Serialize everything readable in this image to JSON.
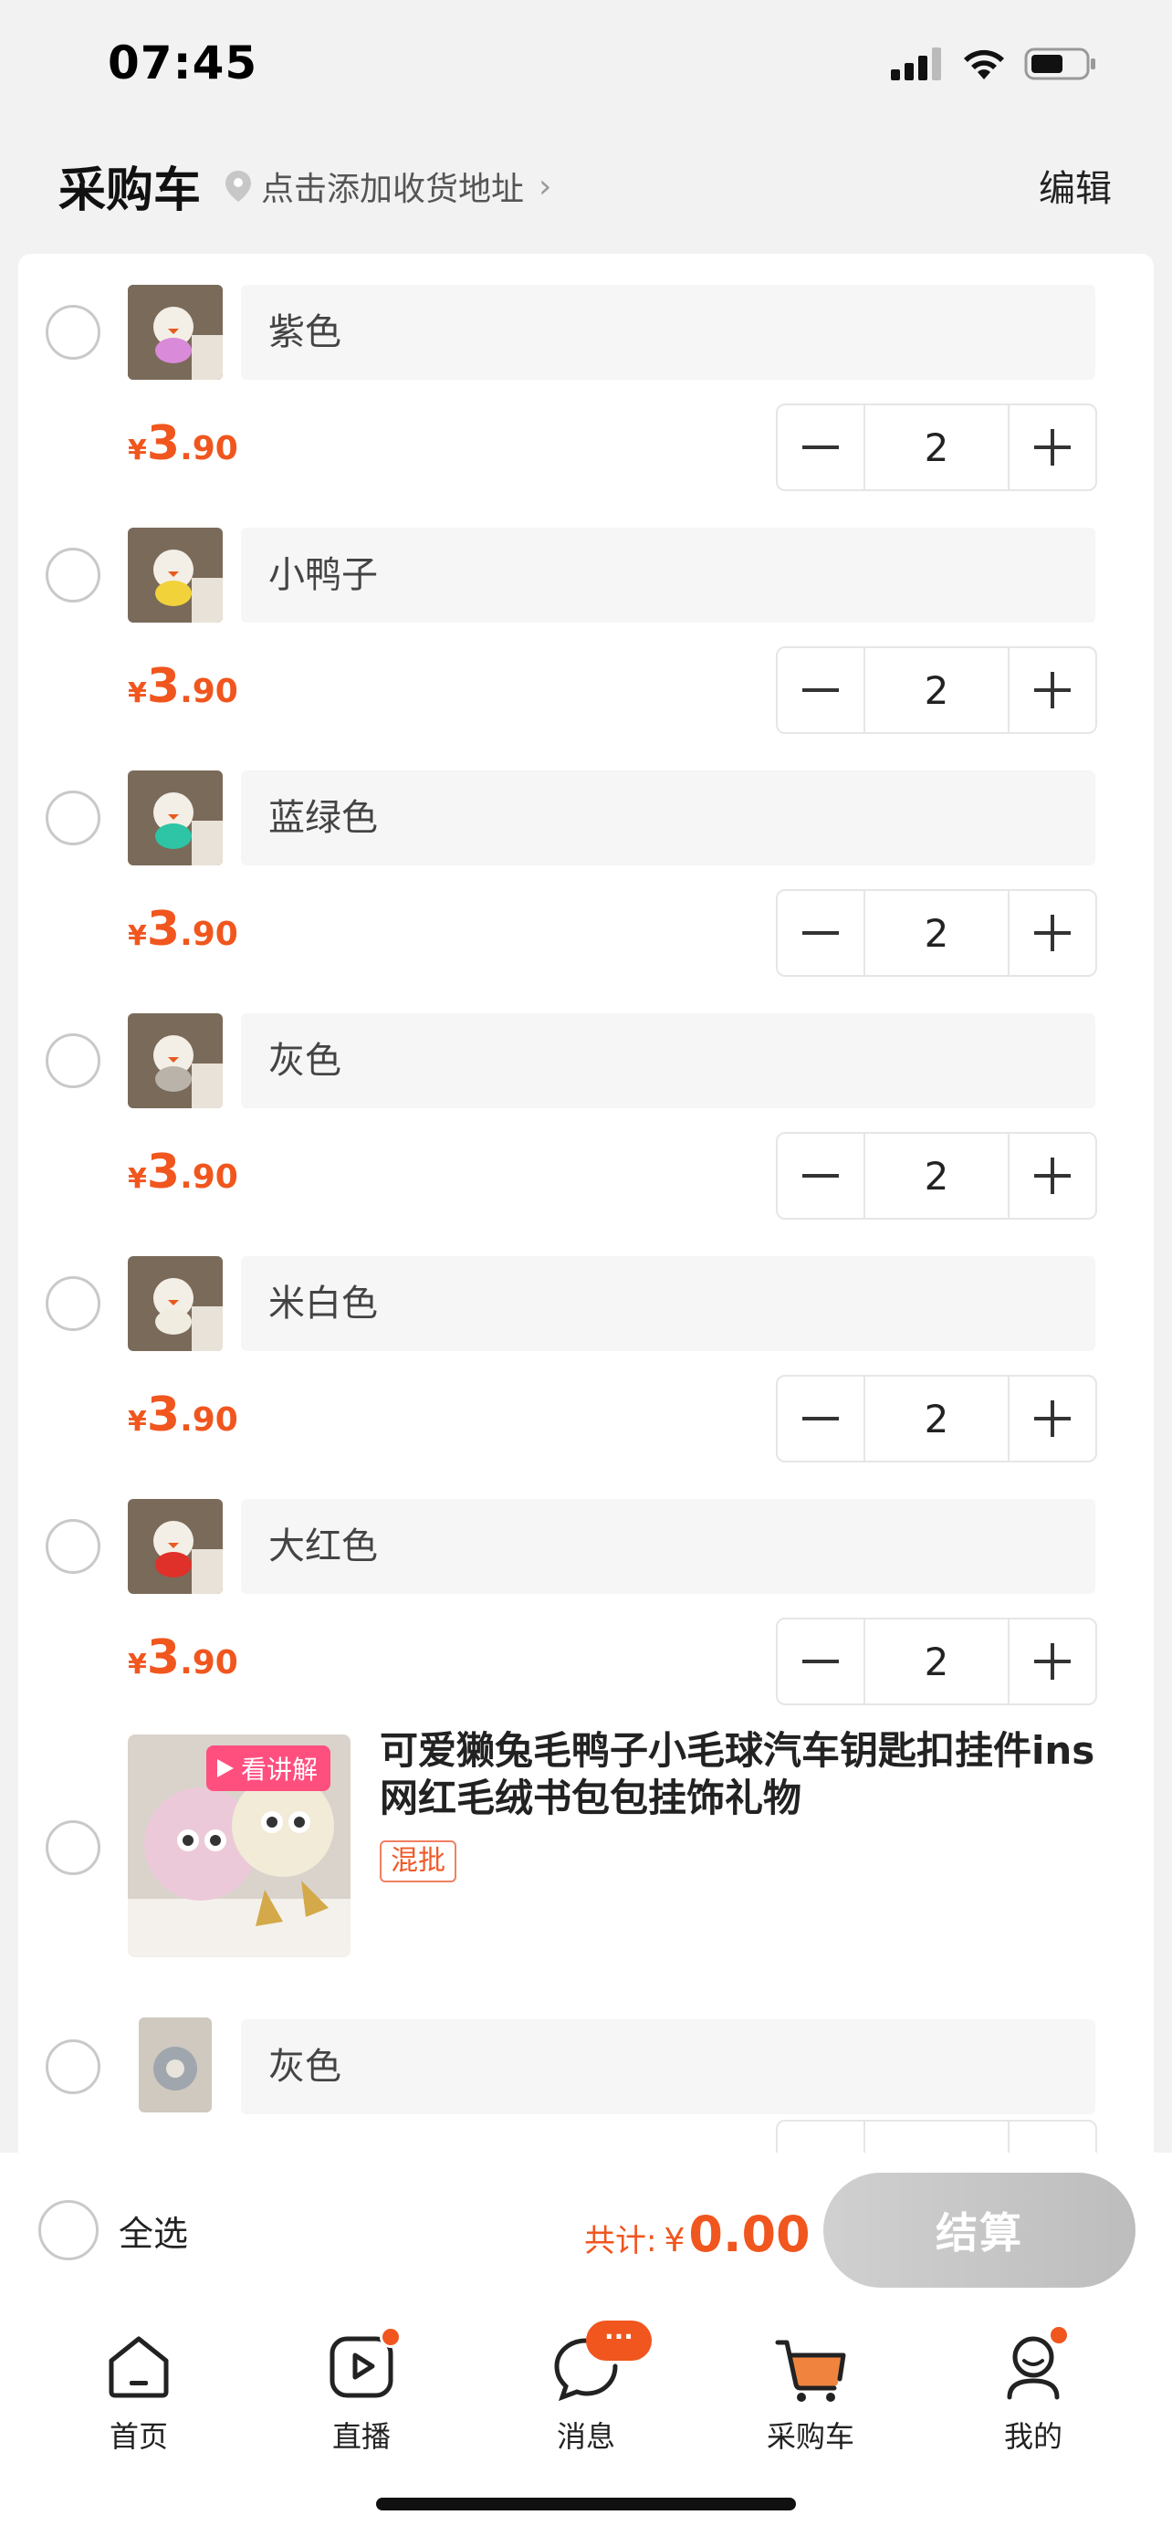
{
  "status_bar": {
    "time": "07:45",
    "icons": [
      "signal-icon",
      "wifi-icon",
      "battery-icon"
    ]
  },
  "header": {
    "title": "采购车",
    "address": "点击添加收货地址",
    "edit": "编辑"
  },
  "cart": {
    "items": [
      {
        "variant": "紫色",
        "price_yen": "¥",
        "price_int": "3",
        "price_dec": ".90",
        "qty": "2",
        "thumb_color": "#d98ad9"
      },
      {
        "variant": "小鸭子",
        "price_yen": "¥",
        "price_int": "3",
        "price_dec": ".90",
        "qty": "2",
        "thumb_color": "#f2d23b"
      },
      {
        "variant": "蓝绿色",
        "price_yen": "¥",
        "price_int": "3",
        "price_dec": ".90",
        "qty": "2",
        "thumb_color": "#2ec4a6"
      },
      {
        "variant": "灰色",
        "price_yen": "¥",
        "price_int": "3",
        "price_dec": ".90",
        "qty": "2",
        "thumb_color": "#b9b3aa"
      },
      {
        "variant": "米白色",
        "price_yen": "¥",
        "price_int": "3",
        "price_dec": ".90",
        "qty": "2",
        "thumb_color": "#f1ece0"
      },
      {
        "variant": "大红色",
        "price_yen": "¥",
        "price_int": "3",
        "price_dec": ".90",
        "qty": "2",
        "thumb_color": "#e0302a"
      }
    ],
    "product": {
      "badge": "看讲解",
      "title": "可爱獭兔毛鸭子小毛球汽车钥匙扣挂件ins网红毛绒书包包挂饰礼物",
      "tag": "混批"
    },
    "partial_item": {
      "variant": "灰色"
    }
  },
  "checkout": {
    "select_all": "全选",
    "total_label": "共计:",
    "total_yen": "¥",
    "total_value": "0.00",
    "button": "结算"
  },
  "tabs": [
    {
      "label": "首页",
      "icon": "home-icon"
    },
    {
      "label": "直播",
      "icon": "live-icon"
    },
    {
      "label": "消息",
      "icon": "message-icon",
      "badge": "···"
    },
    {
      "label": "采购车",
      "icon": "cart-icon"
    },
    {
      "label": "我的",
      "icon": "profile-icon"
    }
  ],
  "colors": {
    "accent": "#f0561e",
    "live_badge": "#ff4f7f"
  }
}
